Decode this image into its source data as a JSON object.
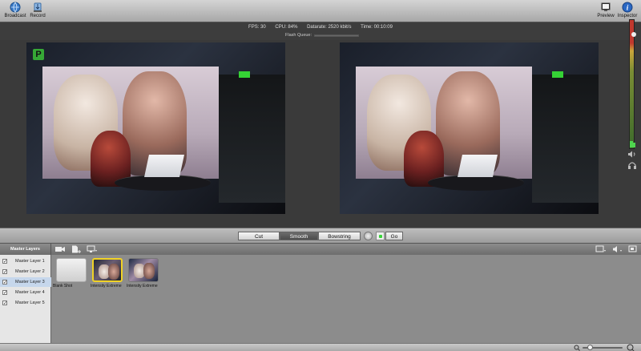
{
  "toolbar": {
    "broadcast_label": "Broadcast",
    "record_label": "Record",
    "preview_label": "Preview",
    "inspector_label": "Inspector"
  },
  "stats": {
    "fps": "FPS: 30",
    "cpu": "CPU: 84%",
    "datarate": "Datarate: 2520 kbit/s",
    "time": "Time: 00:10:09",
    "flash_queue": "Flash Queue:"
  },
  "program": {
    "tally": "P"
  },
  "transitions": {
    "cut": "Cut",
    "smooth": "Smooth",
    "bowstring": "Bowstring",
    "go": "Go",
    "selected": "Smooth"
  },
  "layers": {
    "header": "Master Layers",
    "items": [
      {
        "label": "Master Layer 1",
        "checked": true
      },
      {
        "label": "Master Layer 2",
        "checked": true
      },
      {
        "label": "Master Layer 3",
        "checked": true,
        "selected": true
      },
      {
        "label": "Master Layer 4",
        "checked": true
      },
      {
        "label": "Master Layer 5",
        "checked": true
      }
    ]
  },
  "shots": [
    {
      "label": "Blank Shot",
      "type": "blank"
    },
    {
      "label": "Intensity Extreme",
      "type": "live"
    },
    {
      "label": "Intensity Extreme",
      "type": "cam2"
    }
  ],
  "colors": {
    "tally_green": "#36a836",
    "live_border": "#f0d226",
    "selected_layer": "#c6d7ec"
  },
  "icons": {
    "broadcast": "broadcast-globe-icon",
    "record": "record-icon",
    "preview": "preview-monitor-icon",
    "inspector": "info-icon"
  }
}
